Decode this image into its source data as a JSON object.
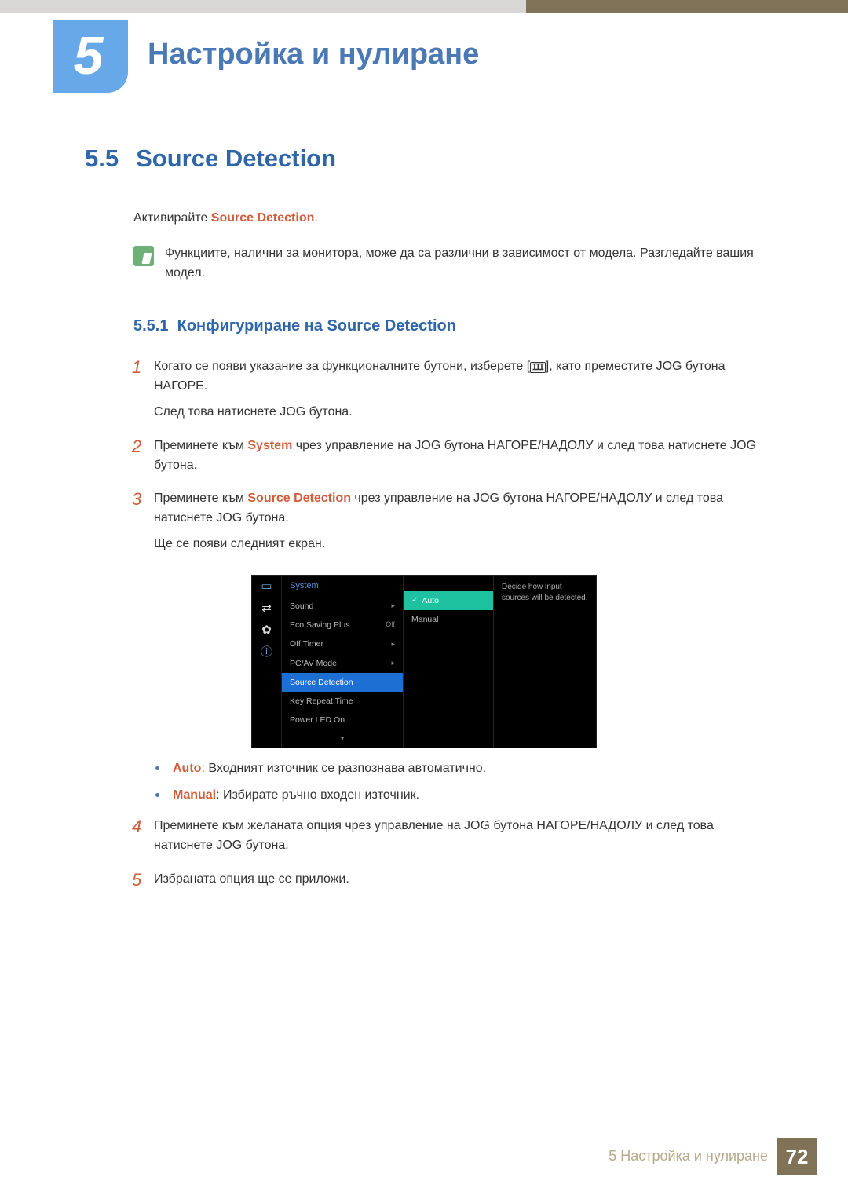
{
  "chapter": {
    "number": "5",
    "title": "Настройка и нулиране"
  },
  "section": {
    "number": "5.5",
    "title": "Source Detection"
  },
  "intro": {
    "prefix": "Активирайте ",
    "term": "Source Detection",
    "suffix": "."
  },
  "note": "Функциите, налични за монитора, може да са различни в зависимост от модела. Разгледайте вашия модел.",
  "subsection": {
    "number": "5.5.1",
    "title": "Конфигуриране на Source Detection"
  },
  "steps": {
    "s1": {
      "n": "1",
      "p1_a": "Когато се появи указание за функционалните бутони, изберете [",
      "p1_b": "], като преместите JOG бутона НАГОРЕ.",
      "p2": "След това натиснете JOG бутона."
    },
    "s2": {
      "n": "2",
      "p1_a": "Преминете към ",
      "term": "System",
      "p1_b": " чрез управление на JOG бутона НАГОРЕ/НАДОЛУ и след това натиснете JOG бутона."
    },
    "s3": {
      "n": "3",
      "p1_a": "Преминете към ",
      "term": "Source Detection",
      "p1_b": " чрез управление на JOG бутона НАГОРЕ/НАДОЛУ и след това натиснете JOG бутона.",
      "p2": "Ще се появи следният екран."
    },
    "s4": {
      "n": "4",
      "p1": "Преминете към желаната опция чрез управление на JOG бутона НАГОРЕ/НАДОЛУ и след това натиснете JOG бутона."
    },
    "s5": {
      "n": "5",
      "p1": "Избраната опция ще се приложи."
    }
  },
  "bullets": {
    "b1": {
      "term": "Auto",
      "txt": ": Входният източник се разпознава автоматично."
    },
    "b2": {
      "term": "Manual",
      "txt": ": Избирате ръчно входен източник."
    }
  },
  "osd": {
    "header": "System",
    "info": "Decide how input sources will be detected.",
    "items": {
      "sound": {
        "label": "Sound",
        "val": "▸"
      },
      "eco": {
        "label": "Eco Saving Plus",
        "val": "Off"
      },
      "offtimer": {
        "label": "Off Timer",
        "val": "▸"
      },
      "pcav": {
        "label": "PC/AV Mode",
        "val": "▸"
      },
      "srcdet": {
        "label": "Source Detection",
        "val": ""
      },
      "keyrep": {
        "label": "Key Repeat Time",
        "val": ""
      },
      "pled": {
        "label": "Power LED On",
        "val": ""
      }
    },
    "options": {
      "auto": "Auto",
      "manual": "Manual"
    },
    "arrow_down": "▾"
  },
  "menu_glyph": "ⵊⵊⵊ",
  "footer": {
    "label": "5 Настройка и нулиране",
    "page": "72"
  }
}
